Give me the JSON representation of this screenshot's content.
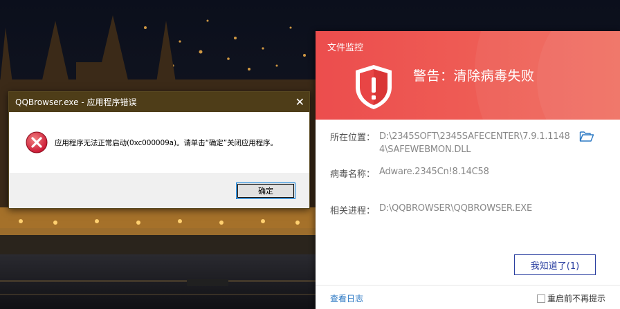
{
  "desktop": {
    "wallpaper": "night-city-parliament-river"
  },
  "error_dialog": {
    "title": "QQBrowser.exe - 应用程序错误",
    "close_glyph": "✕",
    "icon": "error-x-icon",
    "message": "应用程序无法正常启动(0xc000009a)。请单击“确定”关闭应用程序。",
    "ok_label": "确定"
  },
  "av_popup": {
    "title": "文件监控",
    "header_icon": "shield-exclamation-icon",
    "warning": "警告：清除病毒失败",
    "location_label": "所在位置：",
    "location_value": "D:\\2345SOFT\\2345SAFECENTER\\7.9.1.11484\\SAFEWEBMON.DLL",
    "folder_icon": "folder-open-icon",
    "virus_label": "病毒名称：",
    "virus_value": "Adware.2345Cn!8.14C58",
    "process_label": "相关进程：",
    "process_value": "D:\\QQBROWSER\\QQBROWSER.EXE",
    "ack_button": "我知道了(1)",
    "log_link": "查看日志",
    "dont_remind": "重启前不再提示",
    "colors": {
      "header_red": "#ec4d4d",
      "accent_blue": "#2a3fa0",
      "link_blue": "#2b78c4"
    }
  }
}
